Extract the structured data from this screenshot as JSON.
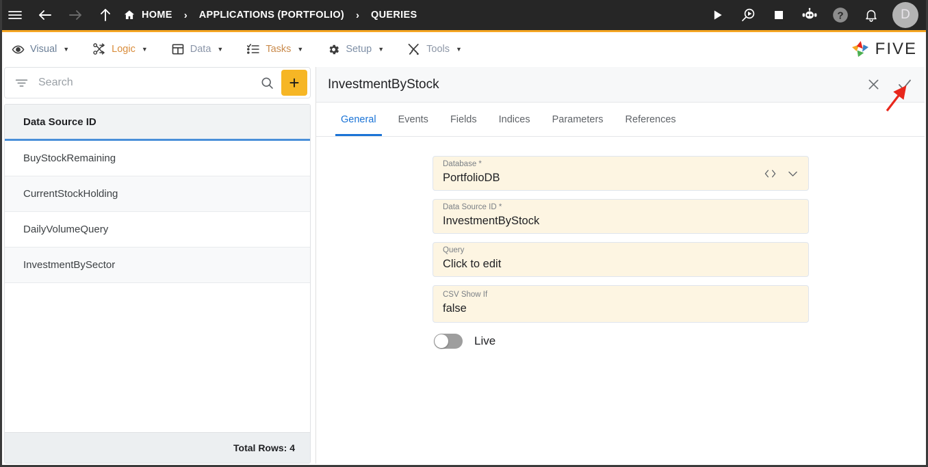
{
  "topbar": {
    "nav_icons": [
      {
        "name": "hamburger-menu-icon",
        "enabled": true
      },
      {
        "name": "back-arrow-icon",
        "enabled": true
      },
      {
        "name": "forward-arrow-icon",
        "enabled": false
      },
      {
        "name": "up-arrow-icon",
        "enabled": true
      }
    ],
    "breadcrumb": [
      {
        "label": "HOME",
        "icon": "home-icon"
      },
      {
        "label": "APPLICATIONS (PORTFOLIO)",
        "icon": ""
      },
      {
        "label": "QUERIES",
        "icon": ""
      }
    ],
    "separator": "›",
    "actions": [
      {
        "name": "run-icon",
        "title": "Run"
      },
      {
        "name": "debug-search-icon",
        "title": "Debug"
      },
      {
        "name": "stop-icon",
        "title": "Stop"
      },
      {
        "name": "chatbot-icon",
        "title": "Assistant"
      },
      {
        "name": "help-icon",
        "title": "Help"
      },
      {
        "name": "notifications-bell-icon",
        "title": "Notifications"
      }
    ],
    "avatar_initial": "D",
    "accent_bar_color": "#f5a623"
  },
  "menubar": {
    "items": [
      {
        "label": "Visual",
        "icon": "eye-icon",
        "caret": "▼"
      },
      {
        "label": "Logic",
        "icon": "logic-nodes-icon",
        "caret": "▼"
      },
      {
        "label": "Data",
        "icon": "table-grid-icon",
        "caret": "▼"
      },
      {
        "label": "Tasks",
        "icon": "checklist-icon",
        "caret": "▼"
      },
      {
        "label": "Setup",
        "icon": "gear-icon",
        "caret": "▼"
      },
      {
        "label": "Tools",
        "icon": "tools-cross-icon",
        "caret": "▼"
      }
    ],
    "brand": "FIVE"
  },
  "sidebar": {
    "search": {
      "value": "",
      "placeholder": "Search"
    },
    "add_button_label": "+",
    "add_button_color": "#f6b625",
    "grid": {
      "column_header": "Data Source ID",
      "header_underline_color": "#4a90d9",
      "rows": [
        {
          "name": "BuyStockRemaining"
        },
        {
          "name": "CurrentStockHolding"
        },
        {
          "name": "DailyVolumeQuery"
        },
        {
          "name": "InvestmentBySector"
        }
      ],
      "footer": "Total Rows: 4"
    }
  },
  "detail": {
    "title": "InvestmentByStock",
    "close_icon": "close-x-icon",
    "save_icon": "checkmark-icon",
    "tabs": [
      {
        "label": "General",
        "active": true
      },
      {
        "label": "Events",
        "active": false
      },
      {
        "label": "Fields",
        "active": false
      },
      {
        "label": "Indices",
        "active": false
      },
      {
        "label": "Parameters",
        "active": false
      },
      {
        "label": "References",
        "active": false
      }
    ],
    "active_tab_color": "#1a73d6",
    "field_background": "#fdf5e2",
    "fields": [
      {
        "label": "Database *",
        "value": "PortfolioDB",
        "icons": [
          "code-brackets-icon",
          "chevron-down-icon"
        ],
        "size": "std"
      },
      {
        "label": "Data Source ID *",
        "value": "InvestmentByStock",
        "icons": [],
        "size": "std"
      },
      {
        "label": "Query",
        "value": "Click to edit",
        "icons": [],
        "size": "std"
      },
      {
        "label": "CSV Show If",
        "value": "false",
        "icons": [],
        "size": "tall"
      }
    ],
    "toggle": {
      "label": "Live",
      "on": false
    }
  },
  "annotation": {
    "arrow_color": "#e8271c",
    "points_to": "checkmark-icon"
  }
}
